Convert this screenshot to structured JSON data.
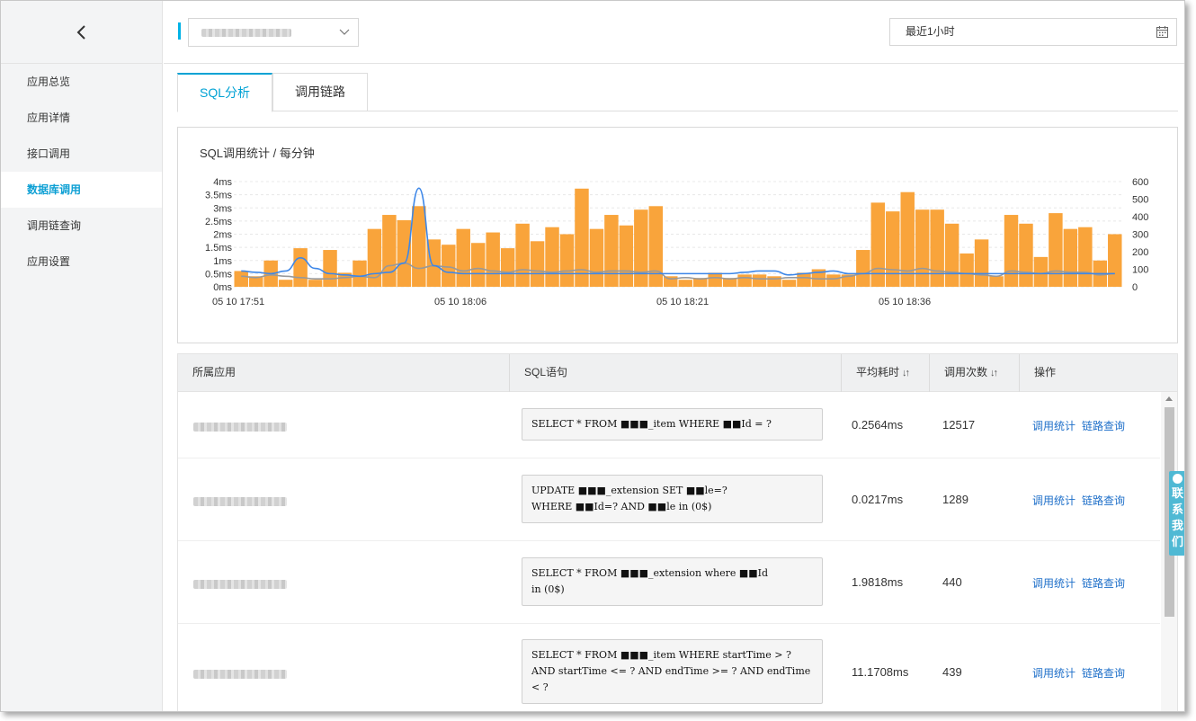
{
  "sidebar": {
    "items": [
      {
        "label": "应用总览"
      },
      {
        "label": "应用详情"
      },
      {
        "label": "接口调用"
      },
      {
        "label": "数据库调用"
      },
      {
        "label": "调用链查询"
      },
      {
        "label": "应用设置"
      }
    ],
    "active_index": 3
  },
  "topbar": {
    "time_range": "最近1小时"
  },
  "tabs": [
    {
      "label": "SQL分析"
    },
    {
      "label": "调用链路"
    }
  ],
  "chart": {
    "title": "SQL调用统计 / 每分钟"
  },
  "chart_data": {
    "type": "bar+line",
    "title": "SQL调用统计 / 每分钟",
    "x_tick_labels": [
      "05 10 17:51",
      "05 10 18:06",
      "05 10 18:21",
      "05 10 18:36"
    ],
    "y_left": {
      "ticks": [
        "0ms",
        "0.5ms",
        "1ms",
        "1.5ms",
        "2ms",
        "2.5ms",
        "3ms",
        "3.5ms",
        "4ms"
      ],
      "range": [
        0,
        4
      ]
    },
    "y_right": {
      "ticks": [
        "0",
        "100",
        "200",
        "300",
        "400",
        "500",
        "600"
      ],
      "range": [
        0,
        600
      ]
    },
    "grid": true,
    "colors": {
      "bars": "#f9a43b",
      "line_blue": "#3d87e8",
      "line_gray": "#999999"
    },
    "series": [
      {
        "kind": "bar",
        "axis": "right",
        "values": [
          90,
          60,
          150,
          40,
          220,
          40,
          210,
          80,
          150,
          330,
          410,
          380,
          460,
          270,
          240,
          330,
          250,
          310,
          220,
          360,
          260,
          340,
          300,
          560,
          330,
          410,
          350,
          440,
          460,
          60,
          40,
          50,
          80,
          50,
          70,
          70,
          60,
          40,
          80,
          100,
          70,
          70,
          210,
          480,
          430,
          540,
          440,
          440,
          360,
          190,
          270,
          60,
          410,
          360,
          170,
          420,
          330,
          340,
          150,
          300
        ]
      },
      {
        "kind": "line",
        "axis": "left",
        "values": [
          0.6,
          0.55,
          0.5,
          0.6,
          1.1,
          0.7,
          0.5,
          0.45,
          0.4,
          0.5,
          0.55,
          0.9,
          3.75,
          0.8,
          0.55,
          0.5,
          0.5,
          0.5,
          0.5,
          0.5,
          0.5,
          0.5,
          0.5,
          0.5,
          0.5,
          0.5,
          0.5,
          0.5,
          0.5,
          0.5,
          0.5,
          0.5,
          0.5,
          0.5,
          0.55,
          0.6,
          0.6,
          0.45,
          0.5,
          0.55,
          0.6,
          0.5,
          0.5,
          0.5,
          0.5,
          0.5,
          0.5,
          0.5,
          0.5,
          0.5,
          0.5,
          0.5,
          0.5,
          0.5,
          0.5,
          0.5,
          0.5,
          0.5,
          0.5,
          0.5
        ]
      },
      {
        "kind": "line",
        "axis": "left",
        "values": [
          0.4,
          0.35,
          0.45,
          0.4,
          0.35,
          0.3,
          0.3,
          0.35,
          0.4,
          0.35,
          0.8,
          0.9,
          0.7,
          0.8,
          0.75,
          0.6,
          0.7,
          0.6,
          0.55,
          0.65,
          0.6,
          0.55,
          0.6,
          0.65,
          0.55,
          0.6,
          0.6,
          0.55,
          0.6,
          0.3,
          0.35,
          0.3,
          0.35,
          0.3,
          0.35,
          0.3,
          0.3,
          0.35,
          0.35,
          0.3,
          0.3,
          0.4,
          0.5,
          0.7,
          0.65,
          0.6,
          0.7,
          0.6,
          0.55,
          0.5,
          0.45,
          0.4,
          0.6,
          0.55,
          0.5,
          0.6,
          0.55,
          0.55,
          0.45,
          0.5
        ]
      }
    ]
  },
  "table": {
    "columns": [
      "所属应用",
      "SQL语句",
      "平均耗时",
      "调用次数",
      "操作"
    ],
    "rows": [
      {
        "sql_lines": [
          "SELECT * FROM ■■■_item WHERE ■■Id = ?"
        ],
        "avg_time": "0.2564ms",
        "count": "12517",
        "op1": "调用统计",
        "op2": "链路查询"
      },
      {
        "sql_lines": [
          "UPDATE ■■■_extension SET ■■le=?",
          "WHERE ■■Id=? AND ■■le  in (0$)"
        ],
        "avg_time": "0.0217ms",
        "count": "1289",
        "op1": "调用统计",
        "op2": "链路查询"
      },
      {
        "sql_lines": [
          "SELECT * FROM ■■■_extension where ■■Id",
          "in (0$)"
        ],
        "avg_time": "1.9818ms",
        "count": "440",
        "op1": "调用统计",
        "op2": "链路查询"
      },
      {
        "sql_lines": [
          "SELECT * FROM ■■■_item WHERE startTime > ?",
          "AND startTime <= ? AND endTime >= ? AND endTime",
          "< ?"
        ],
        "avg_time": "11.1708ms",
        "count": "439",
        "op1": "调用统计",
        "op2": "链路查询"
      }
    ]
  },
  "contact": {
    "label": "联系我们"
  }
}
